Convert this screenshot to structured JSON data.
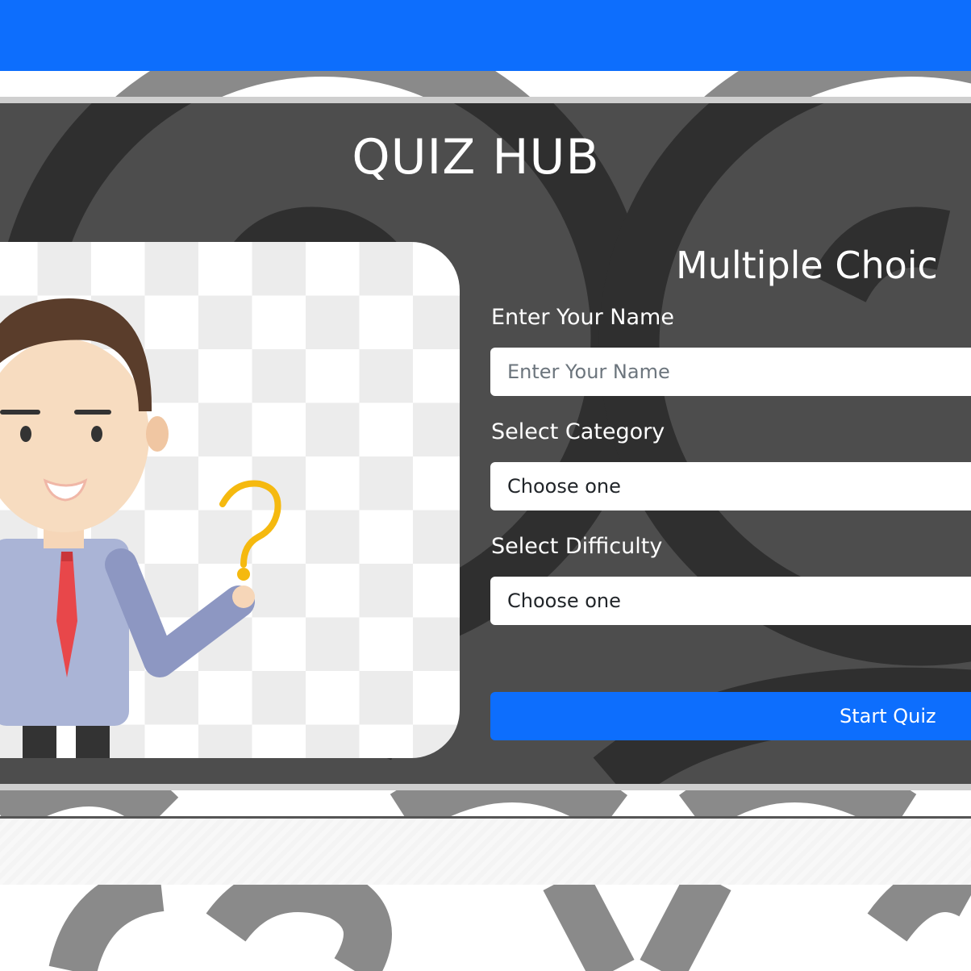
{
  "header": {
    "title": "QUIZ HUB"
  },
  "form": {
    "heading": "Multiple Choic",
    "name_label": "Enter Your Name",
    "name_placeholder": "Enter Your Name",
    "name_value": "",
    "category_label": "Select Category",
    "category_selected": "Choose one",
    "difficulty_label": "Select Difficulty",
    "difficulty_selected": "Choose one",
    "start_label": "Start Quiz"
  },
  "illustration": {
    "subject": "man-with-question-mark"
  },
  "colors": {
    "primary": "#0d6efd",
    "panel": "#4d4d4d",
    "question_mark": "#f5b90f",
    "tie": "#e8474a",
    "shirt": "#aab4d6"
  }
}
